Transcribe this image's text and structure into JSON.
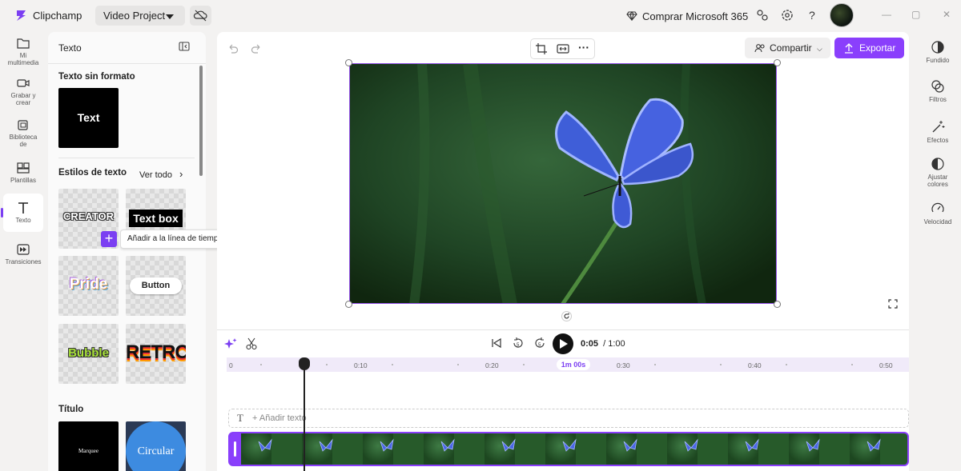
{
  "titlebar": {
    "app_name": "Clipchamp",
    "project_name": "Video Project",
    "buy_label": "Comprar Microsoft 365",
    "window_controls": [
      "—",
      "▢",
      "✕"
    ]
  },
  "left_nav": [
    {
      "label_line1": "Mi",
      "label_line2": "multimedia",
      "icon": "folder-icon"
    },
    {
      "label_line1": "Grabar y",
      "label_line2": "crear",
      "icon": "record-icon"
    },
    {
      "label_line1": "Biblioteca",
      "label_line2": "de",
      "icon": "library-icon"
    },
    {
      "label_line1": "Plantillas",
      "label_line2": "",
      "icon": "templates-icon"
    },
    {
      "label_line1": "Texto",
      "label_line2": "",
      "icon": "text-icon",
      "active": true
    },
    {
      "label_line1": "Transiciones",
      "label_line2": "",
      "icon": "transitions-icon"
    }
  ],
  "panel": {
    "title": "Texto",
    "plain_section": "Texto sin formato",
    "plain_thumb": "Text",
    "styles_section": "Estilos de texto",
    "see_all": "Ver todo",
    "styles": [
      "CREATOR",
      "Text box",
      "Pride",
      "Button",
      "Bubble",
      "RETRO"
    ],
    "title_section": "Título",
    "title_thumbs": [
      "Marquee",
      "Circular"
    ],
    "tooltip": "Añadir a la línea de tiempo"
  },
  "toolbar": {
    "share_label": "Compartir",
    "export_label": "Exportar"
  },
  "timeline": {
    "current_time": "0:05",
    "total_time": "/ 1:00",
    "ticks": [
      "0",
      "0:10",
      "0:20",
      "0:30",
      "0:40",
      "0:50"
    ],
    "end_marker": "1m 00s",
    "add_text": "+ Añadir texto"
  },
  "right_nav": [
    {
      "label_line1": "Fundido",
      "label_line2": "",
      "icon": "fade-icon"
    },
    {
      "label_line1": "Filtros",
      "label_line2": "",
      "icon": "filters-icon"
    },
    {
      "label_line1": "Efectos",
      "label_line2": "",
      "icon": "effects-icon"
    },
    {
      "label_line1": "Ajustar",
      "label_line2": "colores",
      "icon": "adjust-colors-icon"
    },
    {
      "label_line1": "Velocidad",
      "label_line2": "",
      "icon": "speed-icon"
    }
  ],
  "colors": {
    "accent": "#8a3ffc",
    "panel_bg": "#fafafa",
    "app_bg": "#f3f2f1"
  }
}
